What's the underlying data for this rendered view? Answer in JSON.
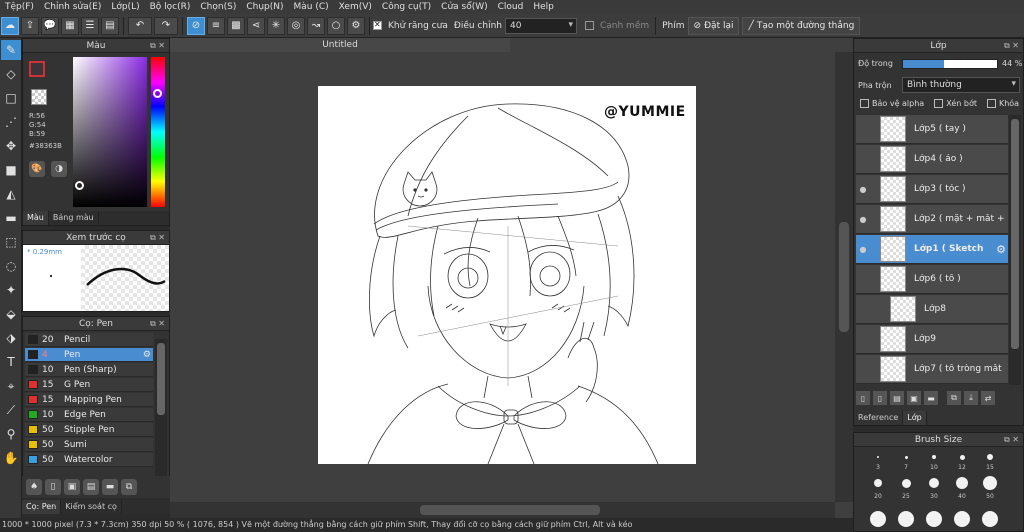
{
  "menu": [
    "Tệp(F)",
    "Chỉnh sửa(E)",
    "Lớp(L)",
    "Bộ lọc(R)",
    "Chọn(S)",
    "Chụp(N)",
    "Màu (C)",
    "Xem(V)",
    "Công cụ(T)",
    "Cửa sổ(W)",
    "Cloud",
    "Help"
  ],
  "toolbar": {
    "antialias_label": "Khử răng cưa",
    "adjust_label": "Điều chỉnh",
    "adjust_value": "40",
    "smooth_label": "Cạnh mềm",
    "key_label": "Phím",
    "reset_label": "Đặt lại",
    "straight_line_label": "Tạo một đường thẳng"
  },
  "color_panel": {
    "title": "Màu",
    "r": "R:56",
    "g": "G:54",
    "b": "B:59",
    "hex": "#38363B",
    "tabs": [
      "Màu",
      "Bảng màu"
    ]
  },
  "preview_panel": {
    "title": "Xem trước cọ",
    "size": "0.29mm"
  },
  "brush_panel": {
    "title": "Cọ: Pen",
    "brushes": [
      {
        "size": "20",
        "name": "Pencil",
        "color": "#222222"
      },
      {
        "size": "4",
        "name": "Pen",
        "color": "#222222"
      },
      {
        "size": "10",
        "name": "Pen (Sharp)",
        "color": "#222222"
      },
      {
        "size": "15",
        "name": "G Pen",
        "color": "#e03030"
      },
      {
        "size": "15",
        "name": "Mapping Pen",
        "color": "#e03030"
      },
      {
        "size": "10",
        "name": "Edge Pen",
        "color": "#22aa22"
      },
      {
        "size": "50",
        "name": "Stipple Pen",
        "color": "#e8c000"
      },
      {
        "size": "50",
        "name": "Sumi",
        "color": "#e8c000"
      },
      {
        "size": "50",
        "name": "Watercolor",
        "color": "#3aa0e0"
      }
    ],
    "tabs": [
      "Cọ: Pen",
      "Kiểm soát cọ"
    ]
  },
  "canvas": {
    "doc_title": "Untitled",
    "watermark": "@YUMMIE"
  },
  "layer_panel": {
    "title": "Lớp",
    "opacity_label": "Độ trong",
    "opacity_value": "44 %",
    "opacity": 0.44,
    "blend_label": "Pha trộn",
    "blend_value": "Bình thường",
    "protect_alpha": "Bảo vệ alpha",
    "clipping": "Xén bớt",
    "lock": "Khóa",
    "layers": [
      {
        "name": "Lớp5 ( tay )",
        "visible": false,
        "selected": false
      },
      {
        "name": "Lớp4 ( áo )",
        "visible": false,
        "selected": false
      },
      {
        "name": "Lớp3 ( tóc )",
        "visible": true,
        "selected": false
      },
      {
        "name": "Lớp2 ( mặt + mắt +",
        "visible": true,
        "selected": false
      },
      {
        "name": "Lớp1 ( Sketch",
        "visible": true,
        "selected": true
      },
      {
        "name": "Lớp6 ( tô )",
        "visible": false,
        "selected": false
      },
      {
        "name": "Lớp8",
        "visible": false,
        "selected": false
      },
      {
        "name": "Lớp9",
        "visible": false,
        "selected": false
      },
      {
        "name": "Lớp7 ( tô tròng mắt",
        "visible": false,
        "selected": false
      }
    ],
    "tabs": [
      "Reference",
      "Lớp"
    ]
  },
  "brush_size_panel": {
    "title": "Brush Size",
    "labels_row1": [
      "3",
      "7",
      "10",
      "12",
      "15"
    ],
    "labels_row2": [
      "20",
      "25",
      "30",
      "40",
      "50"
    ]
  },
  "status": {
    "text": "1000 * 1000 pixel  (7.3 * 7.3cm)  350 dpi  50 %  ( 1076, 854 )  Vẽ một đường thẳng bằng cách giữ phím Shift, Thay đổi cỡ cọ bằng cách giữ phím Ctrl, Alt và kéo"
  },
  "colors": {
    "accent": "#4a8cd0",
    "current_color": "#38363B"
  }
}
